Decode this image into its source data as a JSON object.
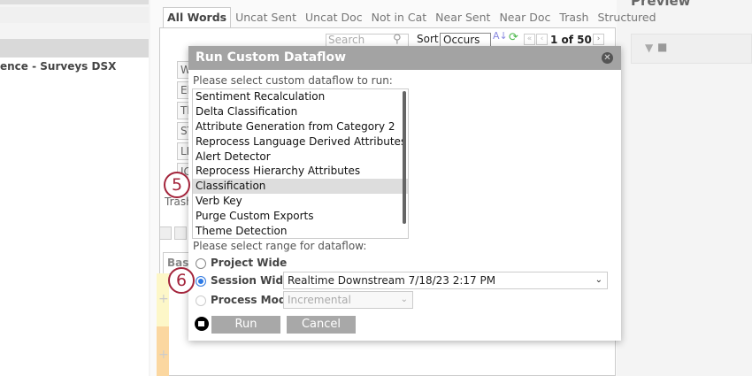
{
  "left": {
    "project": "ence - Surveys DSX"
  },
  "tabs": [
    "All Words",
    "Uncat Sent",
    "Uncat Doc",
    "Not in Cat",
    "Near Sent",
    "Near Doc",
    "Trash",
    "Structured"
  ],
  "toolbar": {
    "search_placeholder": "Search",
    "sort_label": "Sort",
    "sort_value": "Occurs",
    "pager": "1 of 50+"
  },
  "bg_stubs": [
    "W",
    "El",
    "Tl",
    "ST",
    "LI",
    "IC"
  ],
  "trash_label": "Trash",
  "basic_tab": "Basic",
  "preview_title": "Preview",
  "dialog": {
    "title": "Run Custom Dataflow",
    "select_label": "Please select custom dataflow to run:",
    "dataflows": [
      "Sentiment Recalculation",
      "Delta Classification",
      "Attribute Generation from Category 2",
      "Reprocess Language Derived Attributes",
      "Alert Detector",
      "Reprocess Hierarchy Attributes",
      "Classification",
      "Verb Key",
      "Purge Custom Exports",
      "Theme Detection"
    ],
    "selected_dataflow": "Classification",
    "range_label": "Please select range for dataflow:",
    "ranges": {
      "project": "Project Wide",
      "session": "Session Wide",
      "process": "Process Mode"
    },
    "selected_range": "Session Wide",
    "session_value": "Realtime Downstream 7/18/23 2:17 PM",
    "process_value": "Incremental",
    "run": "Run",
    "cancel": "Cancel"
  },
  "steps": {
    "a": "5",
    "b": "6"
  }
}
